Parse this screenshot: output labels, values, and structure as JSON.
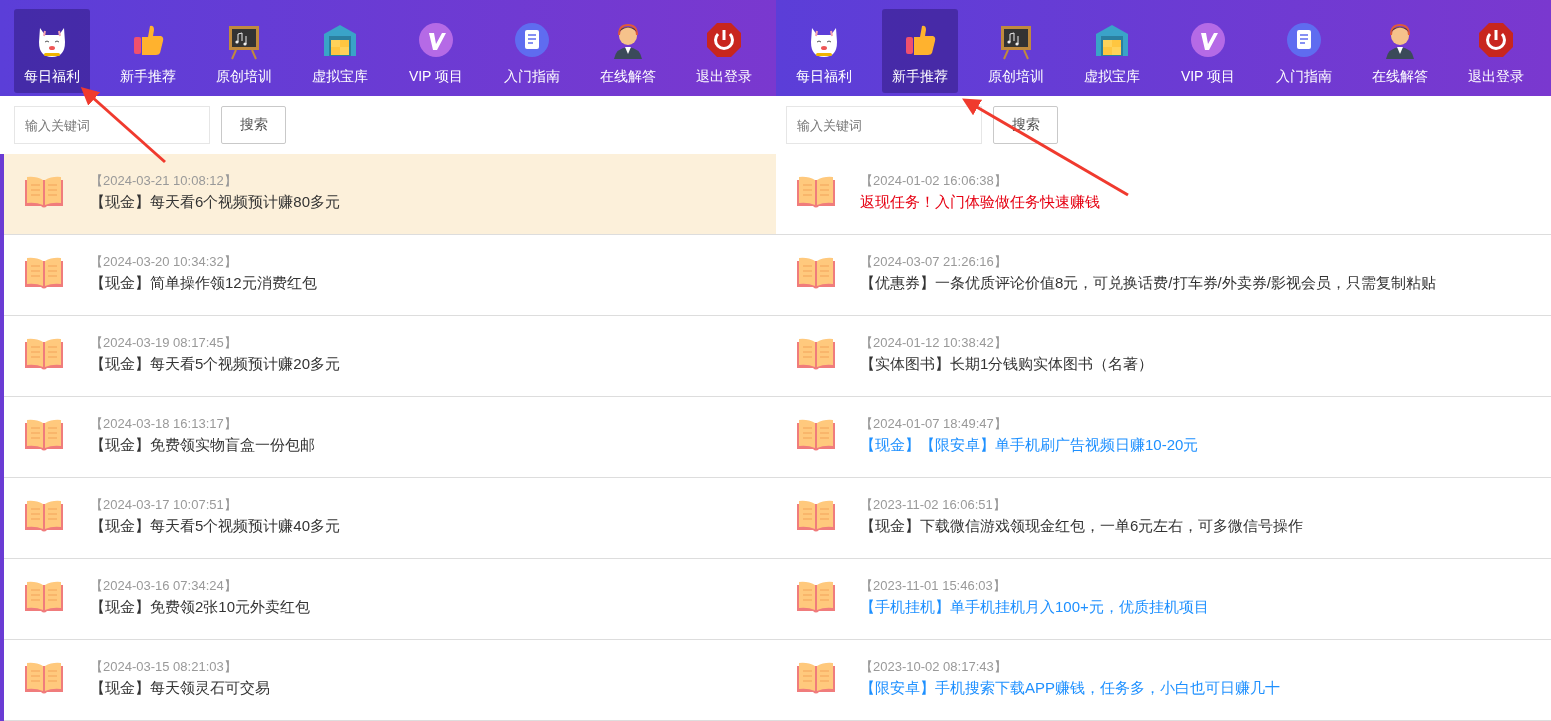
{
  "panels": [
    {
      "nav": [
        {
          "label": "每日福利",
          "selected": true
        },
        {
          "label": "新手推荐",
          "selected": false
        },
        {
          "label": "原创培训",
          "selected": false
        },
        {
          "label": "虚拟宝库",
          "selected": false
        },
        {
          "label": "VIP 项目",
          "selected": false
        },
        {
          "label": "入门指南",
          "selected": false
        },
        {
          "label": "在线解答",
          "selected": false
        },
        {
          "label": "退出登录",
          "selected": false
        }
      ],
      "search": {
        "placeholder": "输入关键词",
        "button": "搜索"
      },
      "articles": [
        {
          "date": "【2024-03-21 10:08:12】",
          "title": "【现金】每天看6个视频预计赚80多元",
          "color": "#333333",
          "selected": true
        },
        {
          "date": "【2024-03-20 10:34:32】",
          "title": "【现金】简单操作领12元消费红包",
          "color": "#333333",
          "selected": false
        },
        {
          "date": "【2024-03-19 08:17:45】",
          "title": "【现金】每天看5个视频预计赚20多元",
          "color": "#333333",
          "selected": false
        },
        {
          "date": "【2024-03-18 16:13:17】",
          "title": "【现金】免费领实物盲盒一份包邮",
          "color": "#333333",
          "selected": false
        },
        {
          "date": "【2024-03-17 10:07:51】",
          "title": "【现金】每天看5个视频预计赚40多元",
          "color": "#333333",
          "selected": false
        },
        {
          "date": "【2024-03-16 07:34:24】",
          "title": "【现金】免费领2张10元外卖红包",
          "color": "#333333",
          "selected": false
        },
        {
          "date": "【2024-03-15 08:21:03】",
          "title": "【现金】每天领灵石可交易",
          "color": "#333333",
          "selected": false
        }
      ]
    },
    {
      "nav": [
        {
          "label": "每日福利",
          "selected": false
        },
        {
          "label": "新手推荐",
          "selected": true
        },
        {
          "label": "原创培训",
          "selected": false
        },
        {
          "label": "虚拟宝库",
          "selected": false
        },
        {
          "label": "VIP 项目",
          "selected": false
        },
        {
          "label": "入门指南",
          "selected": false
        },
        {
          "label": "在线解答",
          "selected": false
        },
        {
          "label": "退出登录",
          "selected": false
        }
      ],
      "search": {
        "placeholder": "输入关键词",
        "button": "搜索"
      },
      "articles": [
        {
          "date": "【2024-01-02 16:06:38】",
          "title": "返现任务！入门体验做任务快速赚钱",
          "color": "#e60012",
          "selected": false
        },
        {
          "date": "【2024-03-07 21:26:16】",
          "title": "【优惠券】一条优质评论价值8元，可兑换话费/打车券/外卖券/影视会员，只需复制粘贴",
          "color": "#333333",
          "selected": false
        },
        {
          "date": "【2024-01-12 10:38:42】",
          "title": "【实体图书】长期1分钱购实体图书（名著）",
          "color": "#333333",
          "selected": false
        },
        {
          "date": "【2024-01-07 18:49:47】",
          "title": "【现金】【限安卓】单手机刷广告视频日赚10-20元",
          "color": "#1e90ff",
          "selected": false
        },
        {
          "date": "【2023-11-02 16:06:51】",
          "title": "【现金】下载微信游戏领现金红包，一单6元左右，可多微信号操作",
          "color": "#333333",
          "selected": false
        },
        {
          "date": "【2023-11-01 15:46:03】",
          "title": "【手机挂机】单手机挂机月入100+元，优质挂机项目",
          "color": "#1e90ff",
          "selected": false
        },
        {
          "date": "【2023-10-02 08:17:43】",
          "title": "【限安卓】手机搜索下载APP赚钱，任务多，小白也可日赚几十",
          "color": "#1e90ff",
          "selected": false
        }
      ]
    }
  ]
}
